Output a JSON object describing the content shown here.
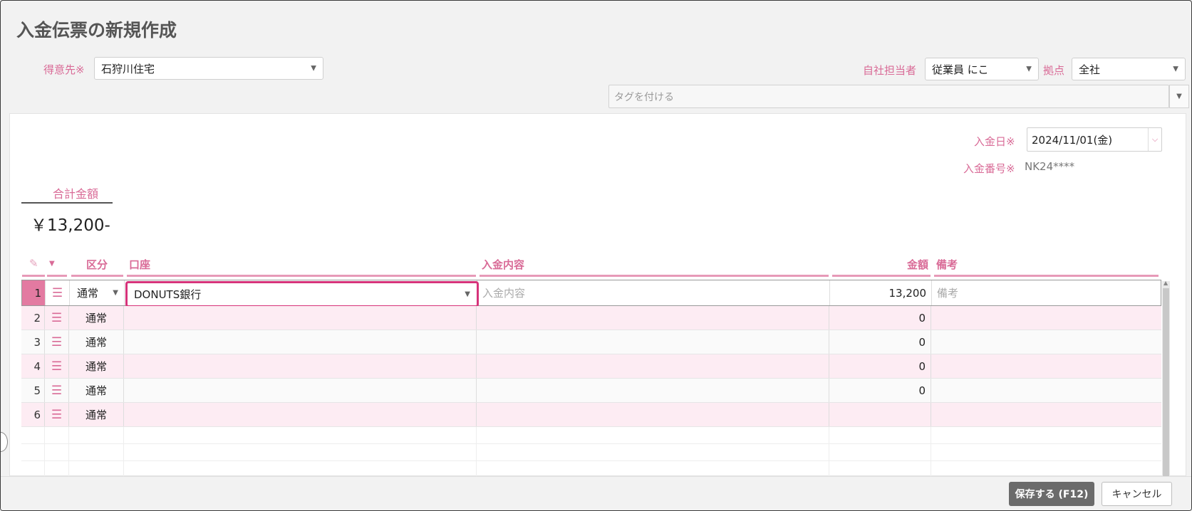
{
  "page": {
    "title": "入金伝票の新規作成"
  },
  "customer": {
    "label": "得意先※",
    "value": "石狩川住宅"
  },
  "staff": {
    "label": "自社担当者",
    "value": "従業員 にこ"
  },
  "branch": {
    "label": "拠点",
    "value": "全社"
  },
  "tags": {
    "placeholder": "タグを付ける"
  },
  "payment_date": {
    "label": "入金日※",
    "value": "2024/11/01(金)"
  },
  "payment_number": {
    "label": "入金番号※",
    "value": "NK24****"
  },
  "total": {
    "label": "合計金額",
    "value": "￥13,200-"
  },
  "table": {
    "headers": {
      "kubun": "区分",
      "koza": "口座",
      "naiyo": "入金内容",
      "kingaku": "金額",
      "biko": "備考"
    },
    "first_row": {
      "num": "1",
      "kubun": "通常",
      "koza": "DONUTS銀行",
      "naiyo_placeholder": "入金内容",
      "kingaku": "13,200",
      "biko_placeholder": "備考"
    },
    "rows": [
      {
        "num": "2",
        "kubun": "通常",
        "kingaku": "0"
      },
      {
        "num": "3",
        "kubun": "通常",
        "kingaku": "0"
      },
      {
        "num": "4",
        "kubun": "通常",
        "kingaku": "0"
      },
      {
        "num": "5",
        "kubun": "通常",
        "kingaku": "0"
      },
      {
        "num": "6",
        "kubun": "通常",
        "kingaku": ""
      }
    ]
  },
  "buttons": {
    "save": "保存する (F12)",
    "cancel": "キャンセル"
  },
  "colors": {
    "accent": "#d96b97",
    "highlight": "#d6337a",
    "row_pink": "#fdecf3"
  }
}
